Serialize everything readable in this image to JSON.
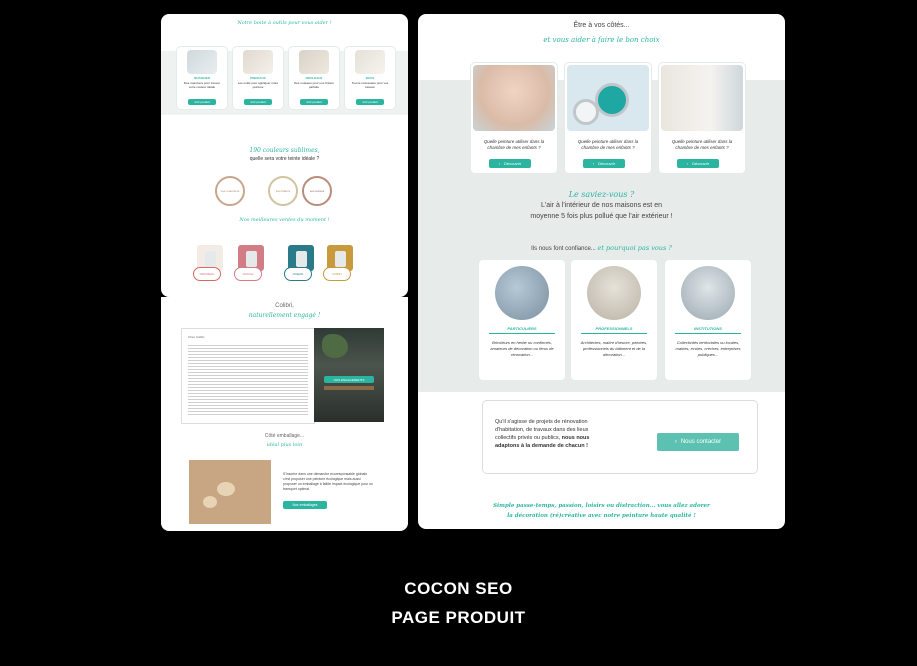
{
  "left_panel": {
    "tools": {
      "heading": "Notre boite à outils pour vous aider !",
      "items": [
        {
          "label": "NUANCIER",
          "desc": "Des nuanciers pour trouver votre couleur idéale",
          "button": "Voir produit"
        },
        {
          "label": "PINCEAUX",
          "desc": "Les outils pour appliquer notre peinture",
          "button": "Voir produit"
        },
        {
          "label": "ROULEAUX",
          "desc": "Des rouleaux pour une finition parfaite",
          "button": "Voir produit"
        },
        {
          "label": "BACS",
          "desc": "Tout le nécessaire pour vos travaux",
          "button": "Voir produit"
        }
      ]
    },
    "colors": {
      "heading_script": "190 couleurs sublimes,",
      "heading": "quelle sera votre teinte idéale ?",
      "swatches": [
        {
          "label": "Les nuanciers",
          "color": "#e8d6c8"
        },
        {
          "label": "Les blancs",
          "color": "#e6ddc6"
        },
        {
          "label": "Les teintes",
          "color": "#d8c2b8"
        }
      ],
      "bestsellers": "Nos meilleures ventes du moment !",
      "products": [
        {
          "label": "NOUVEAU",
          "color": "#f3ece6"
        },
        {
          "label": "ARGILE",
          "color": "#d27c86"
        },
        {
          "label": "OCEAN",
          "color": "#2a7a8a"
        },
        {
          "label": "CURRY",
          "color": "#c99a3c"
        }
      ]
    },
    "colibri": {
      "title": "Colibri,",
      "script": "naturellement engagé !",
      "text_title": "Chez Colibri,",
      "badge": "NOS ENGAGEMENTS",
      "packaging_title": "Côté emballage...",
      "packaging_script": "idéal plus loin",
      "packaging_text": "S'inscrire dans une démarche écoresponsable globale c'est proposer une peinture écologique mais aussi proposer un emballage à faible impact écologique pour un transport optimal.",
      "packaging_button": "Nos emballages"
    }
  },
  "right_panel": {
    "intro": "Être à vos côtés...",
    "intro_script": "et vous aider à faire le bon choix",
    "cards": [
      {
        "text": "Quelle peinture utiliser dans la chambre de mes enfants ?",
        "button": "Découvrir"
      },
      {
        "text": "Quelle peinture utiliser dans la chambre de mes enfants ?",
        "button": "Découvrir"
      },
      {
        "text": "Quelle peinture utiliser dans la chambre de mes enfants ?",
        "button": "Découvrir"
      }
    ],
    "fact_script": "Le saviez-vous ?",
    "fact_line1": "L'air à l'intérieur de nos maisons est en",
    "fact_line2": "moyenne 5 fois plus pollué que l'air extérieur !",
    "trust": "Ils nous font confiance...",
    "trust_script": "et pourquoi pas vous ?",
    "audiences": [
      {
        "label": "PARTICULIERS",
        "text": "Bricoleurs en herbe ou confirmés, amateurs de décoration ou férus de rénovation..."
      },
      {
        "label": "PROFESSIONNELS",
        "text": "Architectes, maître d'œuvre, peintres, professionnels du bâtiment et de la décoration..."
      },
      {
        "label": "INSTITUTIONS",
        "text": "Collectivités territoriales ou locales, mairies, écoles, crèches, entreprises publiques..."
      }
    ],
    "cta_line1": "Qu'il s'agisse de projets de rénovation",
    "cta_line2": "d'habitation, de travaux dans des lieux",
    "cta_line3": "collectifs privés ou publics,",
    "cta_bold1": "nous nous",
    "cta_bold2": "adaptons à la demande de chacun !",
    "cta_button": "Nous contacter",
    "footer_line1": "Simple passe-temps, passion, loisirs ou distraction... vous allez adorer",
    "footer_line2": "la décoration (ré)créative avec notre peinture haute qualité !"
  },
  "caption": {
    "line1": "COCON SEO",
    "line2": "PAGE PRODUIT"
  }
}
